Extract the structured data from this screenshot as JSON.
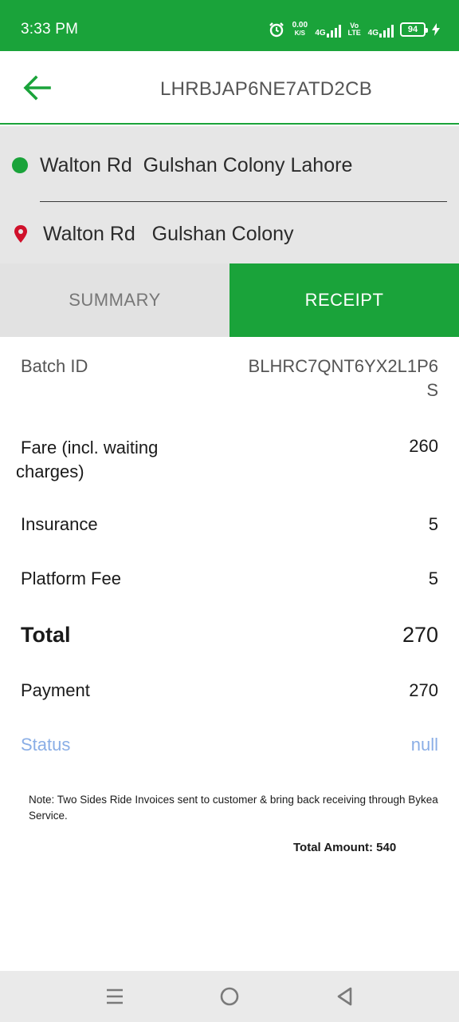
{
  "status_bar": {
    "time": "3:33 PM",
    "speed_value": "0.00",
    "speed_unit": "K/S",
    "net1": "4G",
    "volte_top": "Vo",
    "volte_bottom": "LTE",
    "net2": "4G",
    "battery": "94",
    "icons": [
      "alarm-icon",
      "signal-icon",
      "battery-icon",
      "charging-icon"
    ]
  },
  "header": {
    "back_icon": "arrow-left-icon",
    "title": "LHRBJAP6NE7ATD2CB"
  },
  "route": {
    "pickup": "Walton Rd  Gulshan Colony Lahore",
    "dropoff": "Walton Rd   Gulshan Colony"
  },
  "tabs": [
    {
      "label": "SUMMARY",
      "active": false
    },
    {
      "label": "RECEIPT",
      "active": true
    }
  ],
  "receipt": {
    "batch_id": {
      "label": "Batch ID",
      "value": "BLHRC7QNT6YX2L1P6S"
    },
    "fare": {
      "label": "Fare (incl. waiting charges)",
      "value": "260"
    },
    "insurance": {
      "label": "Insurance",
      "value": "5"
    },
    "platform_fee": {
      "label": "Platform Fee",
      "value": "5"
    },
    "total": {
      "label": "Total",
      "value": "270"
    },
    "payment": {
      "label": "Payment",
      "value": "270"
    },
    "status": {
      "label": "Status",
      "value": "null"
    }
  },
  "note": "Note: Two Sides Ride Invoices sent to customer & bring back receiving through Bykea Service.",
  "total_amount": "Total Amount: 540",
  "colors": {
    "brand_green": "#1aa33a",
    "status_blue": "#8aaee6",
    "pin_red": "#d0112b"
  },
  "nav": [
    "menu-icon",
    "home-icon",
    "back-triangle-icon"
  ]
}
